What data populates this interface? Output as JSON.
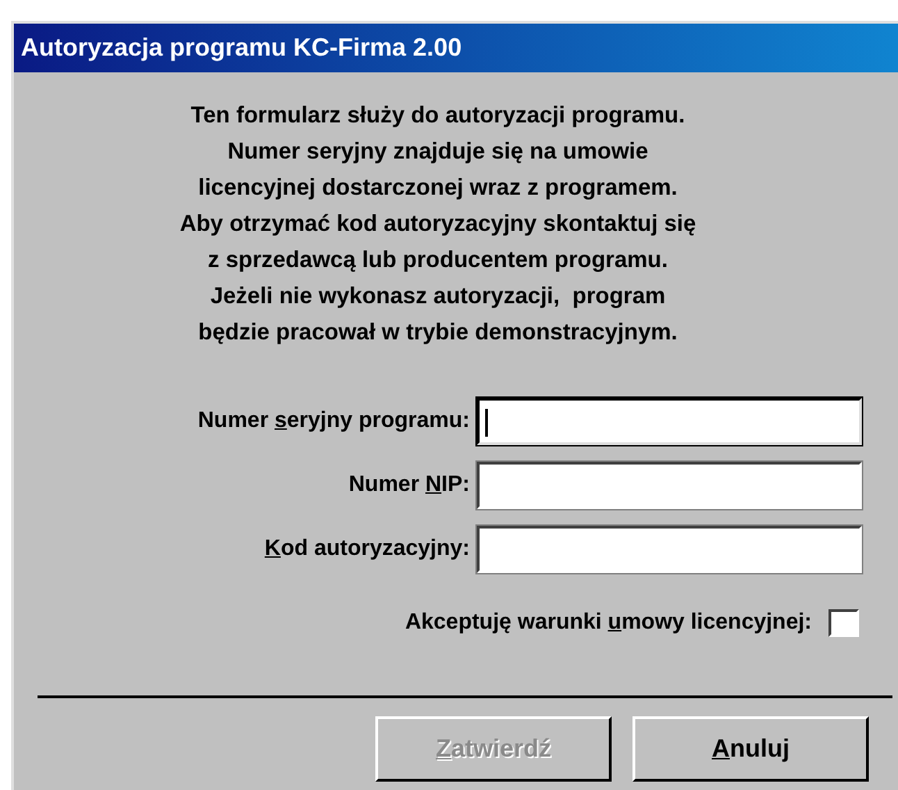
{
  "window": {
    "title": "Autoryzacja programu KC-Firma 2.00"
  },
  "intro_lines": [
    "Ten formularz służy do autoryzacji programu.",
    "Numer seryjny znajduje się na umowie",
    "licencyjnej dostarczonej wraz z programem.",
    "Aby otrzymać kod autoryzacyjny skontaktuj się",
    "z sprzedawcą lub producentem programu.",
    "Jeżeli nie wykonasz autoryzacji,  program",
    "będzie pracował w trybie demonstracyjnym."
  ],
  "fields": [
    {
      "label": {
        "before": "Numer ",
        "key": "s",
        "after": "eryjny programu:"
      },
      "focused": true
    },
    {
      "label": {
        "before": "Numer ",
        "key": "N",
        "after": "IP:"
      },
      "focused": false
    },
    {
      "label": {
        "key": "K",
        "after": "od autoryzacyjny:"
      },
      "focused": false
    }
  ],
  "accept": {
    "label": {
      "before": "Akceptuję warunki ",
      "key": "u",
      "after": "mowy licencyjnej:"
    },
    "checked": false
  },
  "buttons": [
    {
      "label": {
        "key": "Z",
        "after": "atwierdź"
      },
      "disabled": true
    },
    {
      "label": {
        "key": "A",
        "after": "nuluj"
      },
      "disabled": false
    }
  ]
}
